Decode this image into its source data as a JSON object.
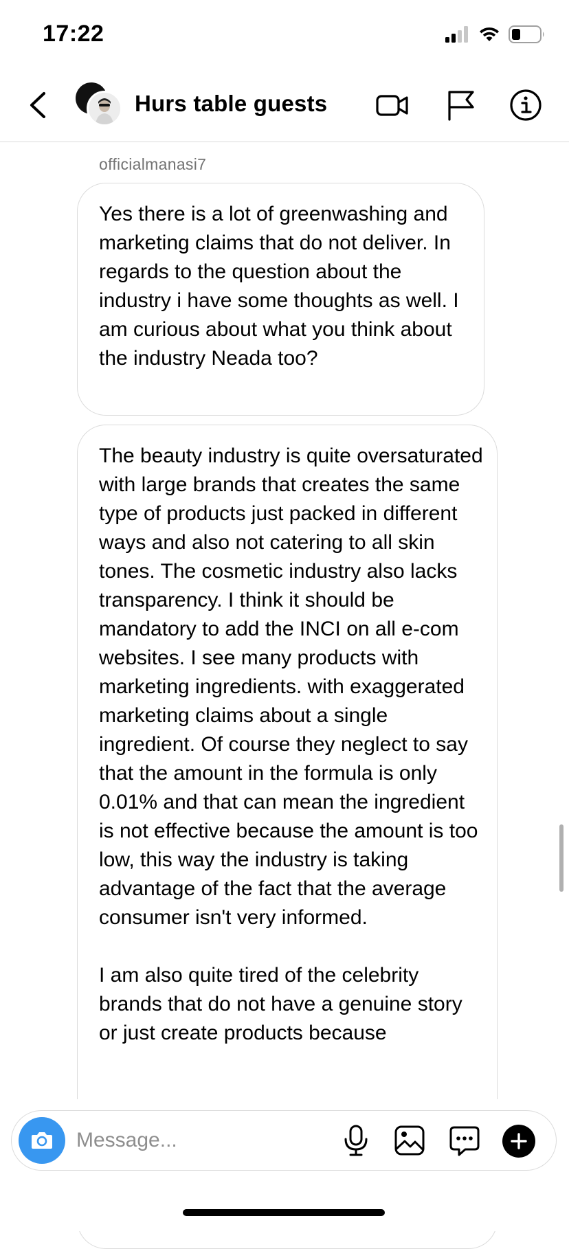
{
  "status_bar": {
    "time": "17:22"
  },
  "header": {
    "title": "Hurs table guests"
  },
  "messages": [
    {
      "sender": "officialmanasi7",
      "text": "Yes there is a lot of greenwashing and marketing claims that do not deliver. In regards to the question about the industry i have some thoughts as well. I am curious about what you think about the industry Neada too?"
    },
    {
      "text": "The beauty industry is quite oversaturated with large brands that creates the same type of products just packed in different ways and also not catering to all skin tones. The cosmetic industry also lacks transparency. I think it should be mandatory to add the INCI on all e-com websites. I see many products with marketing ingredients. with exaggerated marketing claims about a single ingredient. Of course they neglect to say that the amount in the formula is only 0.01% and that can mean the ingredient is not effective because the amount is too low, this way the industry is taking advantage of the fact that the average consumer isn't very informed.\n\nI am also quite tired of the celebrity brands that do not have a genuine story or just create products because"
    }
  ],
  "composer": {
    "placeholder": "Message..."
  },
  "colors": {
    "accent_blue": "#3897f0",
    "border": "#dbdbdb",
    "secondary_text": "#737373"
  },
  "icons": {
    "header": [
      "back-arrow-icon",
      "video-camera-icon",
      "flag-icon",
      "info-icon"
    ],
    "composer": [
      "camera-icon",
      "microphone-icon",
      "gallery-icon",
      "sticker-icon",
      "plus-icon"
    ]
  }
}
